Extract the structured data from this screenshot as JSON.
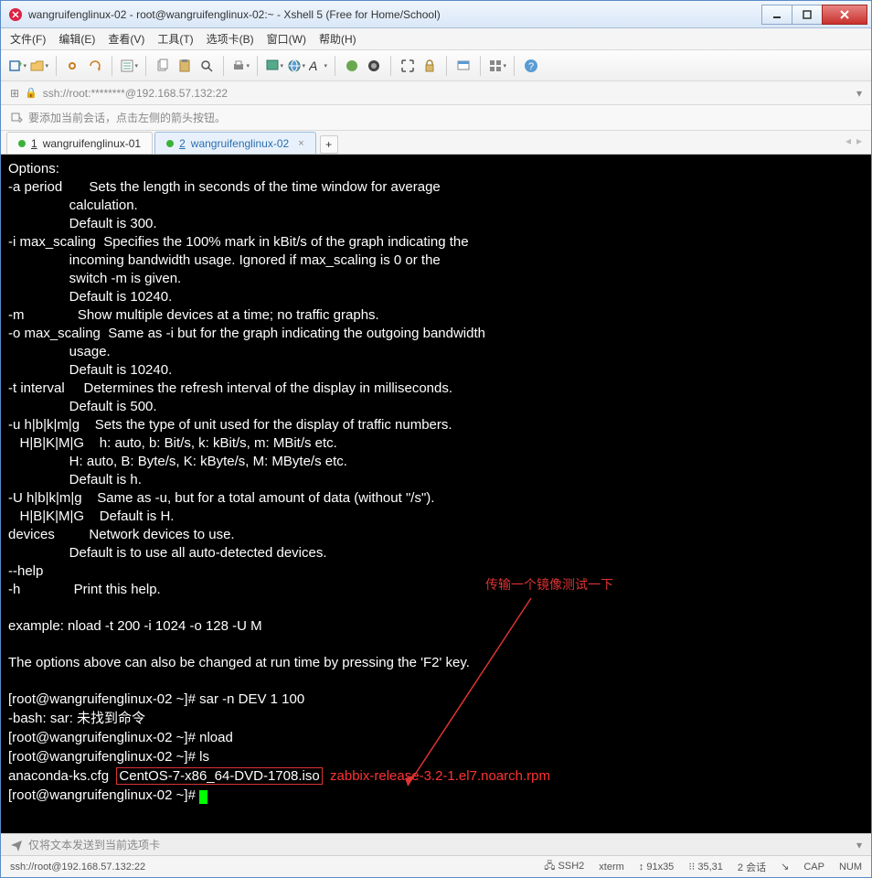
{
  "window": {
    "title": "wangruifenglinux-02 - root@wangruifenglinux-02:~ - Xshell 5 (Free for Home/School)"
  },
  "menu": {
    "file": "文件(F)",
    "edit": "编辑(E)",
    "view": "查看(V)",
    "tools": "工具(T)",
    "tabs": "选项卡(B)",
    "window": "窗口(W)",
    "help": "帮助(H)"
  },
  "address": {
    "url": "ssh://root:********@192.168.57.132:22"
  },
  "infobar": {
    "text": "要添加当前会话，点击左侧的箭头按钮。"
  },
  "tabs": {
    "items": [
      {
        "num": "1",
        "label": "wangruifenglinux-01",
        "active": false
      },
      {
        "num": "2",
        "label": "wangruifenglinux-02",
        "active": true
      }
    ],
    "add": "+"
  },
  "terminal": {
    "lines": [
      "Options:",
      "-a period       Sets the length in seconds of the time window for average",
      "                calculation.",
      "                Default is 300.",
      "-i max_scaling  Specifies the 100% mark in kBit/s of the graph indicating the",
      "                incoming bandwidth usage. Ignored if max_scaling is 0 or the",
      "                switch -m is given.",
      "                Default is 10240.",
      "-m              Show multiple devices at a time; no traffic graphs.",
      "-o max_scaling  Same as -i but for the graph indicating the outgoing bandwidth",
      "                usage.",
      "                Default is 10240.",
      "-t interval     Determines the refresh interval of the display in milliseconds.",
      "                Default is 500.",
      "-u h|b|k|m|g    Sets the type of unit used for the display of traffic numbers.",
      "   H|B|K|M|G    h: auto, b: Bit/s, k: kBit/s, m: MBit/s etc.",
      "                H: auto, B: Byte/s, K: kByte/s, M: MByte/s etc.",
      "                Default is h.",
      "-U h|b|k|m|g    Same as -u, but for a total amount of data (without \"/s\").",
      "   H|B|K|M|G    Default is H.",
      "devices         Network devices to use.",
      "                Default is to use all auto-detected devices.",
      "--help",
      "-h              Print this help.",
      "",
      "example: nload -t 200 -i 1024 -o 128 -U M",
      "",
      "The options above can also be changed at run time by pressing the 'F2' key.",
      ""
    ],
    "cmd1_prompt": "[root@wangruifenglinux-02 ~]# ",
    "cmd1": "sar -n DEV 1 100",
    "err1": "-bash: sar: 未找到命令",
    "cmd2_prompt": "[root@wangruifenglinux-02 ~]# ",
    "cmd2": "nload",
    "cmd3_prompt": "[root@wangruifenglinux-02 ~]# ",
    "cmd3": "ls",
    "ls_file1": "anaconda-ks.cfg  ",
    "ls_file2": "CentOS-7-x86_64-DVD-1708.iso",
    "ls_file3": "  zabbix-release-3.2-1.el7.noarch.rpm",
    "cmd4_prompt": "[root@wangruifenglinux-02 ~]# "
  },
  "annotation": {
    "text": "传输一个镜像测试一下"
  },
  "sendbar": {
    "text": "仅将文本发送到当前选项卡"
  },
  "status": {
    "left": "ssh://root@192.168.57.132:22",
    "ssh": "SSH2",
    "term": "xterm",
    "size": "91x35",
    "pos": "35,31",
    "sess": "2 会话",
    "cap": "CAP",
    "num": "NUM"
  },
  "icons": {
    "minimize": "minimize-icon",
    "maximize": "maximize-icon",
    "close": "close-icon",
    "new": "new-tab-icon",
    "open": "open-folder-icon",
    "link": "link-icon",
    "reconnect": "reconnect-icon",
    "properties": "properties-icon",
    "copy": "copy-icon",
    "paste": "paste-icon",
    "find": "find-icon",
    "print": "print-icon",
    "screen": "fullscreen-icon",
    "font": "font-icon",
    "globe": "globe-icon",
    "fontsize": "fontsize-icon",
    "color1": "color-scheme-icon",
    "color2": "color-scheme-icon",
    "tile": "tile-icon",
    "lock": "lock-icon",
    "session": "session-icon",
    "layout": "layout-icon",
    "help": "help-icon",
    "addr_lock": "lock-icon",
    "addr_dd": "dropdown-icon",
    "info_arrow": "add-session-icon",
    "send": "send-icon",
    "sizegrip": "resize-grip-icon"
  }
}
